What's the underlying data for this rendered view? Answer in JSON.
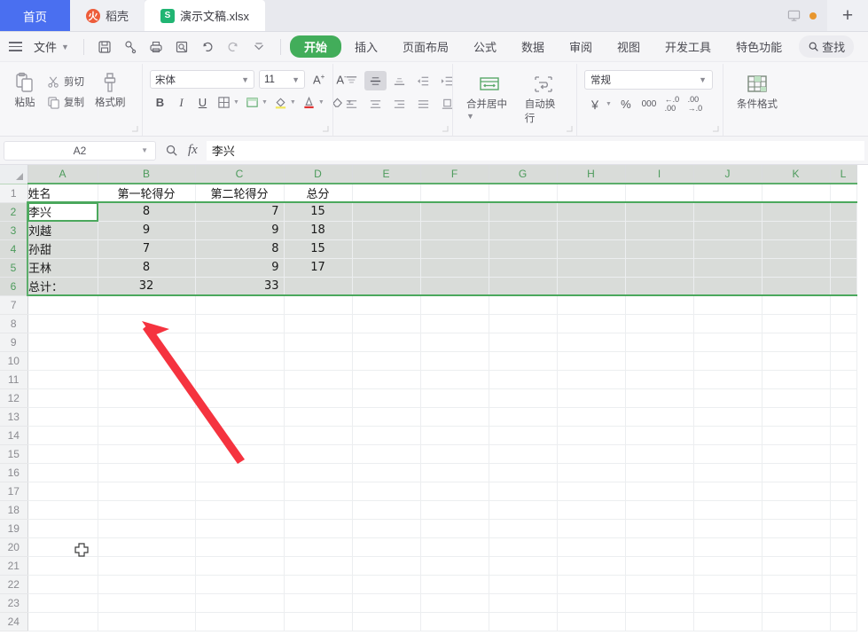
{
  "window": {
    "tabs": [
      {
        "label": "首页",
        "icon": "",
        "state": "home"
      },
      {
        "label": "稻壳",
        "icon": "dao-icon",
        "state": "inactive"
      },
      {
        "label": "演示文稿.xlsx",
        "icon": "xlsx-icon",
        "state": "active"
      }
    ],
    "monitor_icon": "monitor-icon",
    "status_dot": "orange-dot-icon",
    "new_tab_label": "+"
  },
  "menu": {
    "hamburger": "hamburger-icon",
    "file_label": "文件",
    "quick_icons": [
      "save-icon",
      "search-doc-icon",
      "print-icon",
      "print-preview-icon",
      "undo-icon",
      "redo-icon",
      "customize-icon"
    ],
    "ribbon_tabs": [
      {
        "label": "开始",
        "selected": true
      },
      {
        "label": "插入",
        "selected": false
      },
      {
        "label": "页面布局",
        "selected": false
      },
      {
        "label": "公式",
        "selected": false
      },
      {
        "label": "数据",
        "selected": false
      },
      {
        "label": "审阅",
        "selected": false
      },
      {
        "label": "视图",
        "selected": false
      },
      {
        "label": "开发工具",
        "selected": false
      },
      {
        "label": "特色功能",
        "selected": false
      }
    ],
    "find_label": "查找"
  },
  "ribbon": {
    "clipboard": {
      "paste_label": "粘贴",
      "cut_label": "剪切",
      "copy_label": "复制",
      "format_painter_label": "格式刷"
    },
    "font": {
      "family_value": "宋体",
      "size_value": "11",
      "grow_label": "A",
      "shrink_label": "A",
      "bold_label": "B",
      "italic_label": "I",
      "underline_label": "U",
      "border_icon": "border-icon",
      "cellstyle_icon": "cell-style-icon",
      "fill_icon": "fill-color-icon",
      "fontcolor_icon": "font-color-icon",
      "clearfmt_icon": "clear-format-icon"
    },
    "alignment": {
      "top_icon": "align-top-icon",
      "middle_icon": "align-middle-icon",
      "bottom_icon": "align-bottom-icon",
      "decrease_indent_icon": "decrease-indent-icon",
      "increase_indent_icon": "increase-indent-icon",
      "left_icon": "align-left-icon",
      "center_icon": "align-center-icon",
      "right_icon": "align-right-icon",
      "justify_icon": "justify-icon",
      "orientation_icon": "text-orientation-icon",
      "merge_label": "合并居中",
      "wrap_label": "自动换行"
    },
    "number": {
      "format_value": "常规",
      "currency_icon": "currency-icon",
      "percent_icon": "percent-icon",
      "comma_icon": "comma-style-icon",
      "increase_decimal_icon": "increase-decimal-icon",
      "decrease_decimal_icon": "decrease-decimal-icon"
    },
    "styles": {
      "conditional_label": "条件格式"
    }
  },
  "formula_bar": {
    "name_box_value": "A2",
    "zoom_icon": "search-icon",
    "fx_label": "fx",
    "formula_value": "李兴"
  },
  "sheet": {
    "columns": [
      "A",
      "B",
      "C",
      "D",
      "E",
      "F",
      "G",
      "H",
      "I",
      "J",
      "K",
      "L"
    ],
    "rows": [
      1,
      2,
      3,
      4,
      5,
      6,
      7,
      8,
      9,
      10,
      11,
      12,
      13,
      14,
      15,
      16,
      17,
      18,
      19,
      20,
      21,
      22,
      23,
      24
    ],
    "selected_rows": [
      2,
      3,
      4,
      5,
      6
    ],
    "active_cell": "A2",
    "data": [
      {
        "row": 1,
        "A": "姓名",
        "B": "第一轮得分",
        "C": "第二轮得分",
        "D": "总分"
      },
      {
        "row": 2,
        "A": "李兴",
        "B": "8",
        "C": "7",
        "D": "15"
      },
      {
        "row": 3,
        "A": "刘越",
        "B": "9",
        "C": "9",
        "D": "18"
      },
      {
        "row": 4,
        "A": "孙甜",
        "B": "7",
        "C": "8",
        "D": "15"
      },
      {
        "row": 5,
        "A": "王林",
        "B": "8",
        "C": "9",
        "D": "17"
      },
      {
        "row": 6,
        "A": "总计：",
        "B": "32",
        "C": "33",
        "D": ""
      }
    ]
  },
  "annotation": {
    "arrow_color": "#f5333f",
    "arrow_name": "red-pointer-arrow",
    "cursor_name": "move-cursor"
  },
  "colors": {
    "accent_green": "#42ad5a",
    "selection_green": "#4ba85d",
    "home_tab_blue": "#4a6ff0",
    "selection_gray": "#d9dcd9"
  }
}
